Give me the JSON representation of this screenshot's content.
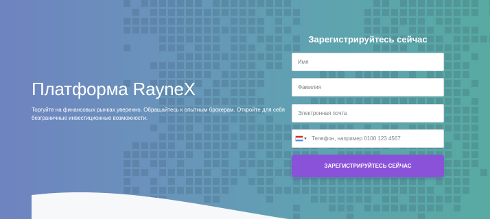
{
  "hero": {
    "headline": "Платформа RayneX",
    "subtitle": "Торгуйте на финансовых рынках уверенно. Обращайтесь к опытным брокерам. Откройте для себя безграничные инвестиционные возможности."
  },
  "form": {
    "title": "Зарегистрируйтесь сейчас",
    "first_name_placeholder": "Имя",
    "last_name_placeholder": "Фамилия",
    "email_placeholder": "Электронная почта",
    "phone_placeholder": "Телефон, например 0100 123 4567",
    "submit_label": "ЗАРЕГИСТРИРУЙТЕСЬ СЕЙЧАС"
  },
  "colors": {
    "gradient_start": "#6e83c0",
    "gradient_end": "#58aaa2",
    "button": "#8a52d9"
  },
  "icons": {
    "country_flag": "flag-icon",
    "dropdown": "chevron-down-icon"
  }
}
